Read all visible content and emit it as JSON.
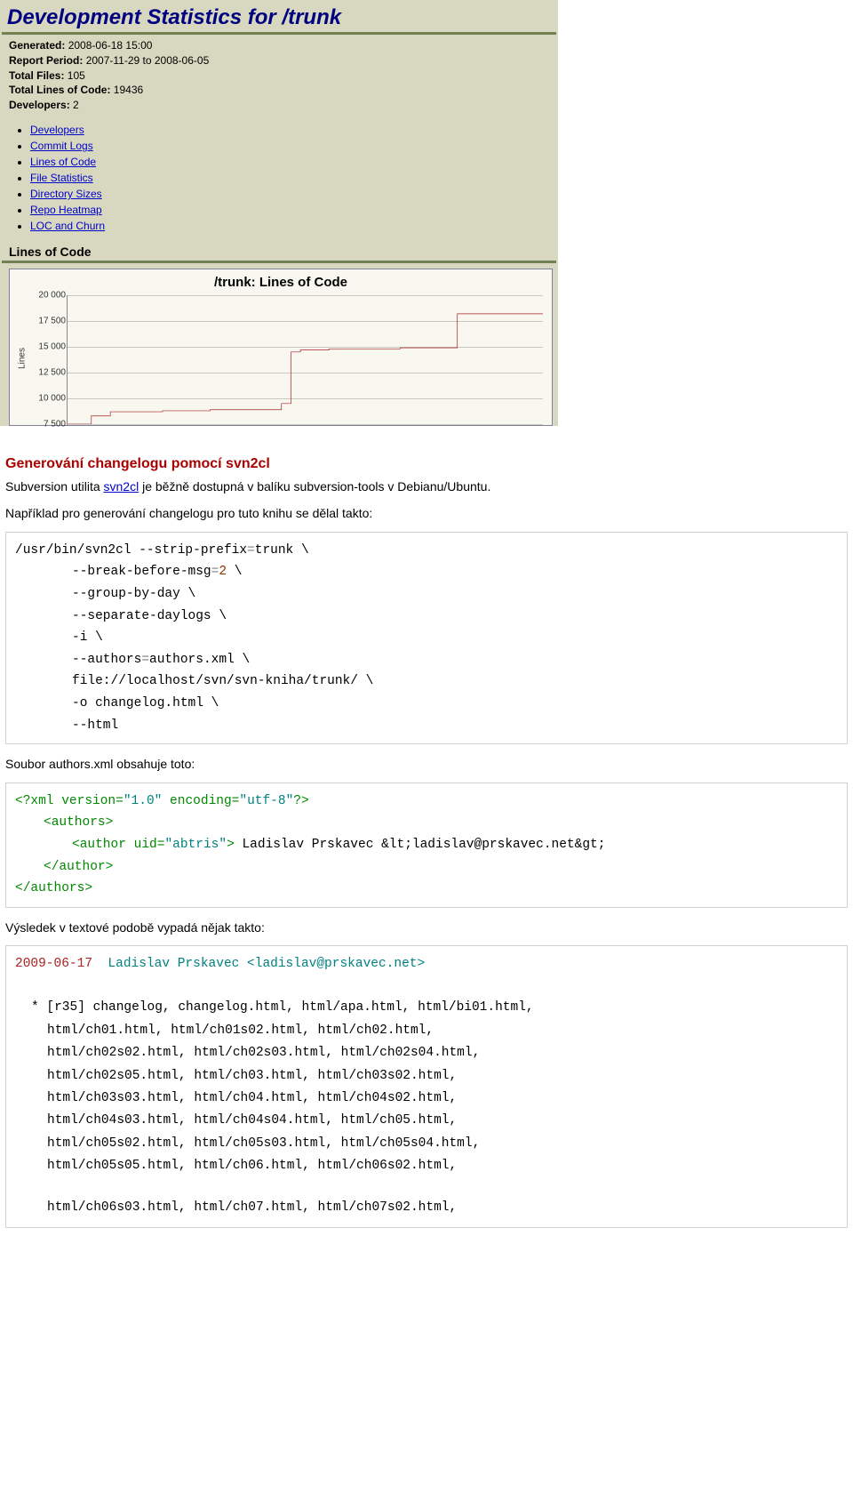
{
  "stats": {
    "title": "Development Statistics for /trunk",
    "generated_label": "Generated:",
    "generated_value": "2008-06-18 15:00",
    "period_label": "Report Period:",
    "period_value": "2007-11-29 to 2008-06-05",
    "files_label": "Total Files:",
    "files_value": "105",
    "loc_label": "Total Lines of Code:",
    "loc_value": "19436",
    "dev_label": "Developers:",
    "dev_value": "2",
    "nav": [
      "Developers",
      "Commit Logs",
      "Lines of Code",
      "File Statistics",
      "Directory Sizes",
      "Repo Heatmap",
      "LOC and Churn"
    ],
    "section_label": "Lines of Code"
  },
  "chart_data": {
    "type": "line",
    "title": "/trunk: Lines of Code",
    "ylabel": "Lines",
    "yticks": [
      "20 000",
      "17 500",
      "15 000",
      "12 500",
      "10 000",
      "7 500"
    ],
    "ylim": [
      7500,
      20000
    ],
    "series": [
      {
        "name": "lines",
        "color": "#aa2222",
        "x": [
          0.0,
          0.02,
          0.05,
          0.07,
          0.09,
          0.12,
          0.2,
          0.3,
          0.4,
          0.45,
          0.47,
          0.49,
          0.55,
          0.6,
          0.7,
          0.8,
          0.82,
          0.84,
          0.9,
          0.95,
          1.0
        ],
        "values": [
          7500,
          7500,
          8300,
          8300,
          8700,
          8700,
          8800,
          8900,
          8900,
          9500,
          14500,
          14700,
          14800,
          14800,
          14900,
          14900,
          18200,
          18200,
          18200,
          18200,
          18200
        ]
      }
    ]
  },
  "article": {
    "h_gen": "Generování changelogu pomocí svn2cl",
    "p_sub_a": "Subversion utilita ",
    "p_sub_link": "svn2cl",
    "p_sub_b": " je běžně dostupná v balíku subversion-tools v Debianu/Ubuntu.",
    "p_example": "Například pro generování changelogu pro tuto knihu se dělal takto:",
    "cmd": {
      "l1a": "/usr/bin/svn2cl --strip-prefix",
      "l1eq": "=",
      "l1b": "trunk \\",
      "l2a": "--break-before-msg",
      "l2eq": "=",
      "l2num": "2",
      "l2b": " \\",
      "l3": "--group-by-day \\",
      "l4": "--separate-daylogs \\",
      "l5": "-i \\",
      "l6a": "--authors",
      "l6eq": "=",
      "l6b": "authors.xml \\",
      "l7": "file://localhost/svn/svn-kniha/trunk/ \\",
      "l8": "-o changelog.html \\",
      "l9": "--html"
    },
    "p_authors": "Soubor authors.xml obsahuje toto:",
    "xml": {
      "decl_a": "<?xml ",
      "decl_v": "version=",
      "decl_vq": "\"1.0\"",
      "decl_e": " encoding=",
      "decl_eq": "\"utf-8\"",
      "decl_c": "?>",
      "authors_o": "<authors>",
      "author_o": "<author ",
      "author_attr": "uid=",
      "author_val": "\"abtris\"",
      "author_oc": ">",
      "author_text": " Ladislav Prskavec &lt;ladislav@prskavec.net&gt;",
      "author_c": "</author>",
      "authors_c": "</authors>"
    },
    "p_result": "Výsledek v textové podobě vypadá nějak takto:",
    "log": {
      "date": "2009-06-17",
      "name": "  Ladislav Prskavec <ladislav@prskavec.net>",
      "rows": [
        "* [r35] changelog, changelog.html, html/apa.html, html/bi01.html,",
        "html/ch01.html, html/ch01s02.html, html/ch02.html,",
        "html/ch02s02.html, html/ch02s03.html, html/ch02s04.html,",
        "html/ch02s05.html, html/ch03.html, html/ch03s02.html,",
        "html/ch03s03.html, html/ch04.html, html/ch04s02.html,",
        "html/ch04s03.html, html/ch04s04.html, html/ch05.html,",
        "html/ch05s02.html, html/ch05s03.html, html/ch05s04.html,",
        "html/ch05s05.html, html/ch06.html, html/ch06s02.html,",
        "html/ch06s03.html, html/ch07.html, html/ch07s02.html,"
      ]
    }
  }
}
